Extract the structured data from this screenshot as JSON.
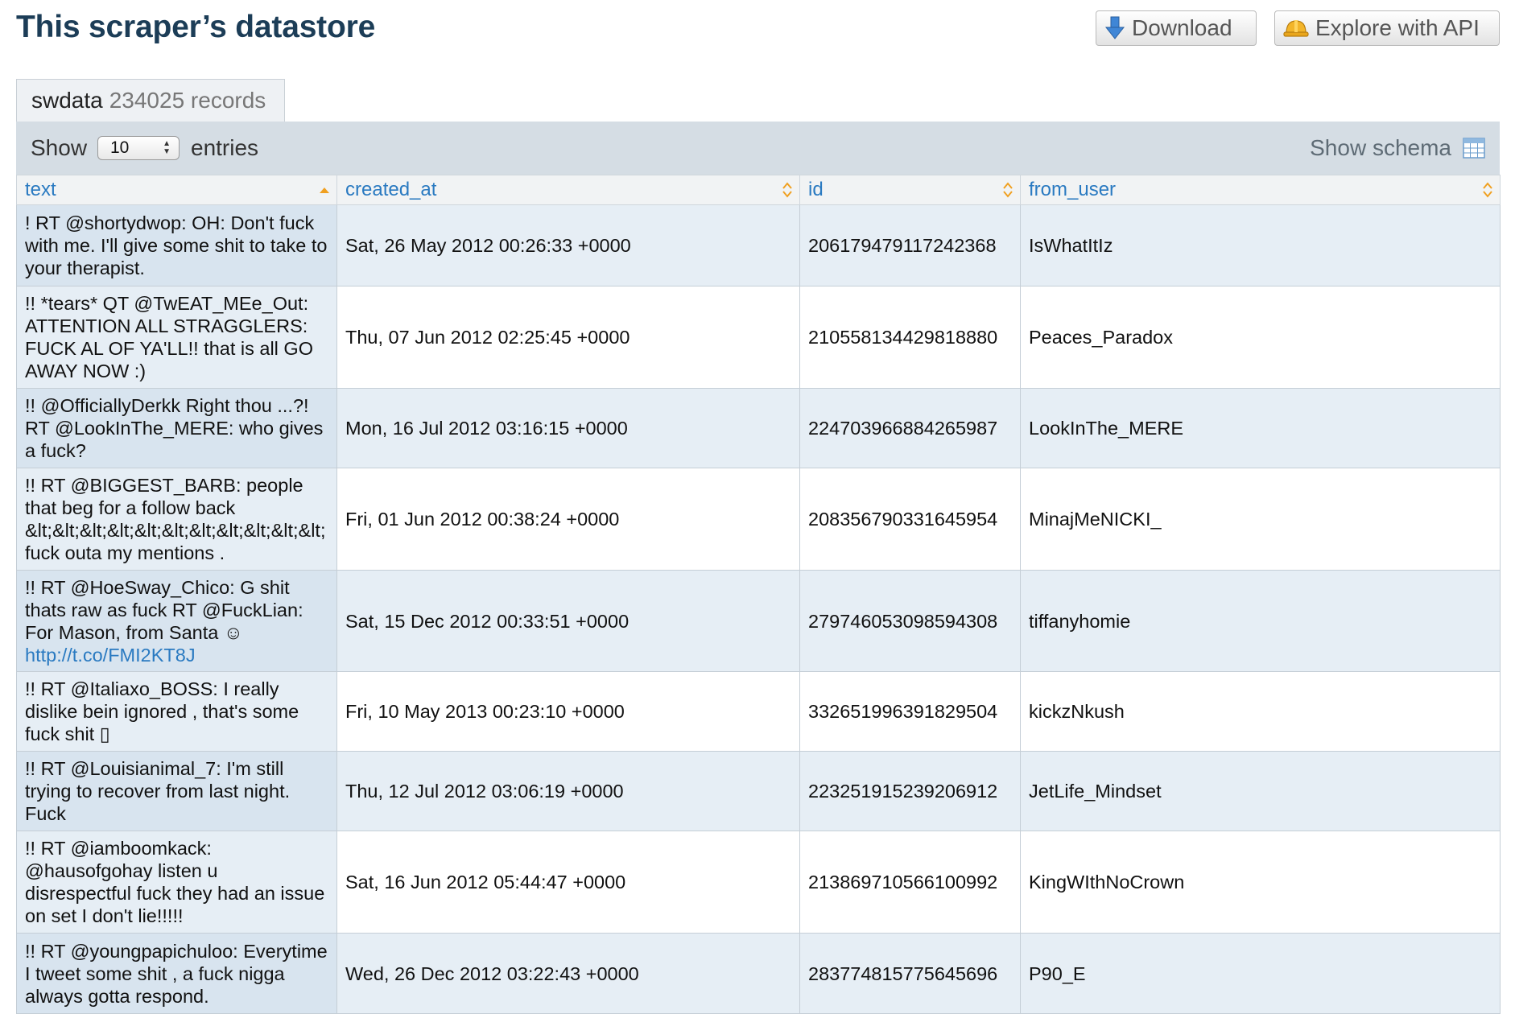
{
  "header": {
    "title": "This scraper’s datastore",
    "download_label": "Download",
    "explore_label": "Explore with API"
  },
  "tab": {
    "name": "swdata",
    "count": "234025 records"
  },
  "toolbar": {
    "show_label": "Show",
    "entries_value": "10",
    "entries_label": "entries",
    "schema_label": "Show schema"
  },
  "table": {
    "columns": [
      "text",
      "created_at",
      "id",
      "from_user"
    ],
    "sorted_column": "text",
    "rows": [
      {
        "text": "! RT @shortydwop: OH: Don't fuck with me. I'll give some shit to take to your therapist.",
        "created_at": "Sat, 26 May 2012 00:26:33 +0000",
        "id": "206179479117242368",
        "from_user": "IsWhatItIz"
      },
      {
        "text": "!! *tears* QT @TwEAT_MEe_Out: ATTENTION ALL STRAGGLERS: FUCK AL OF YA'LL!! that is all GO AWAY NOW :)",
        "created_at": "Thu, 07 Jun 2012 02:25:45 +0000",
        "id": "210558134429818880",
        "from_user": "Peaces_Paradox"
      },
      {
        "text": "!! @OfficiallyDerkk Right thou ...?! RT @LookInThe_MERE: who gives a fuck?",
        "created_at": "Mon, 16 Jul 2012 03:16:15 +0000",
        "id": "224703966884265987",
        "from_user": "LookInThe_MERE"
      },
      {
        "text": "!! RT @BIGGEST_BARB: people that beg for a follow back &lt;&lt;&lt;&lt;&lt;&lt;&lt;&lt;&lt;&lt;&lt; fuck outa my mentions .",
        "created_at": "Fri, 01 Jun 2012 00:38:24 +0000",
        "id": "208356790331645954",
        "from_user": "MinajMeNICKI_"
      },
      {
        "text": "!! RT @HoeSway_Chico: G shit thats raw as fuck RT @FuckLian: For Mason, from Santa ☺",
        "link": "http://t.co/FMI2KT8J",
        "created_at": "Sat, 15 Dec 2012 00:33:51 +0000",
        "id": "279746053098594308",
        "from_user": "tiffanyhomie"
      },
      {
        "text": "!! RT @Italiaxo_BOSS: I really dislike bein ignored , that's some fuck shit ▯",
        "created_at": "Fri, 10 May 2013 00:23:10 +0000",
        "id": "332651996391829504",
        "from_user": "kickzNkush"
      },
      {
        "text": "!! RT @Louisianimal_7: I'm still trying to recover from last night. Fuck",
        "created_at": "Thu, 12 Jul 2012 03:06:19 +0000",
        "id": "223251915239206912",
        "from_user": "JetLife_Mindset"
      },
      {
        "text": "!! RT @iamboomkack: @hausofgohay listen u disrespectful fuck they had an issue on set I don't lie!!!!!",
        "created_at": "Sat, 16 Jun 2012 05:44:47 +0000",
        "id": "213869710566100992",
        "from_user": "KingWIthNoCrown"
      },
      {
        "text": "!! RT @youngpapichuloo: Everytime I tweet some shit , a fuck nigga always gotta respond.",
        "created_at": "Wed, 26 Dec 2012 03:22:43 +0000",
        "id": "283774815775645696",
        "from_user": "P90_E"
      }
    ]
  },
  "colors": {
    "title": "#1c3d57",
    "link": "#2a7ac1",
    "sort_active": "#f0a020",
    "toolbar_bg": "#d5dde4",
    "row_alt_bg": "#e6eef5"
  },
  "icons": {
    "download": "download-arrow-icon",
    "explore": "hard-hat-icon",
    "schema": "table-grid-icon",
    "sort": "sort-arrows-icon"
  }
}
